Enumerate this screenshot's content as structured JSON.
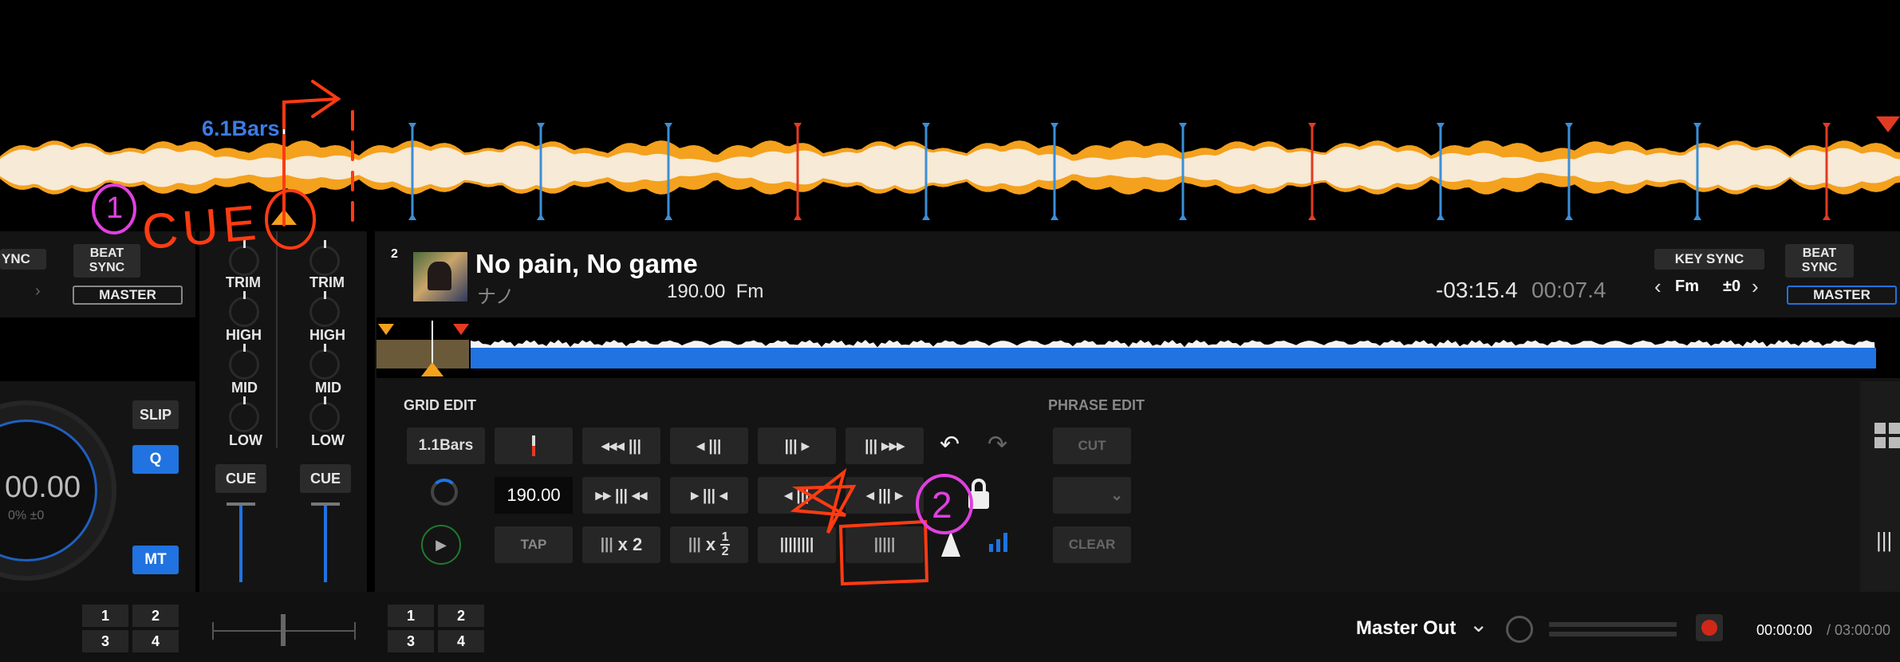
{
  "top_waveform": {
    "bars_label": "6.1Bars"
  },
  "left_deck": {
    "sync_label": "YNC",
    "beat_sync_label": "BEAT\nSYNC",
    "master_label": "MASTER",
    "slip_label": "SLIP",
    "q_label": "Q",
    "mt_label": "MT",
    "tempo_value": "00.00",
    "tempo_range": "0% ±0"
  },
  "mixer": {
    "trim_label": "TRIM",
    "high_label": "HIGH",
    "mid_label": "MID",
    "low_label": "LOW",
    "cue_label": "CUE"
  },
  "deck2": {
    "deck_number": "2",
    "title": "No pain, No game",
    "artist": "ナノ",
    "bpm_key": "190.00  Fm",
    "time_remaining": "-03:15.4",
    "time_elapsed": "00:07.4",
    "key_sync_label": "KEY SYNC",
    "key_value": "Fm",
    "key_shift": "±0",
    "beat_sync_label": "BEAT\nSYNC",
    "master_label": "MASTER"
  },
  "grid_edit": {
    "title": "GRID EDIT",
    "bars_button": "1.1Bars",
    "bpm_value": "190.00",
    "tap_label": "TAP",
    "x2_label": "x 2",
    "half_label": "x",
    "half_num": "1",
    "half_den": "2"
  },
  "phrase_edit": {
    "title": "PHRASE EDIT",
    "cut_label": "CUT",
    "clear_label": "CLEAR"
  },
  "bottom_bar": {
    "pads_left": [
      "1",
      "2",
      "3",
      "4"
    ],
    "pads_right": [
      "1",
      "2",
      "3",
      "4"
    ],
    "master_out_label": "Master Out",
    "rec_time": "00:00:00",
    "rec_total": "/ 03:00:00"
  },
  "annotations": {
    "circle_1": "1",
    "cue_text": "CUE",
    "circle_2": "2"
  },
  "colors": {
    "accent_blue": "#2073e0",
    "wave_orange": "#f4a11d",
    "beat_blue": "#3a8fd8",
    "beat_red": "#e33b22",
    "annotation_red": "#ff3b12",
    "annotation_pink": "#e040e0"
  }
}
